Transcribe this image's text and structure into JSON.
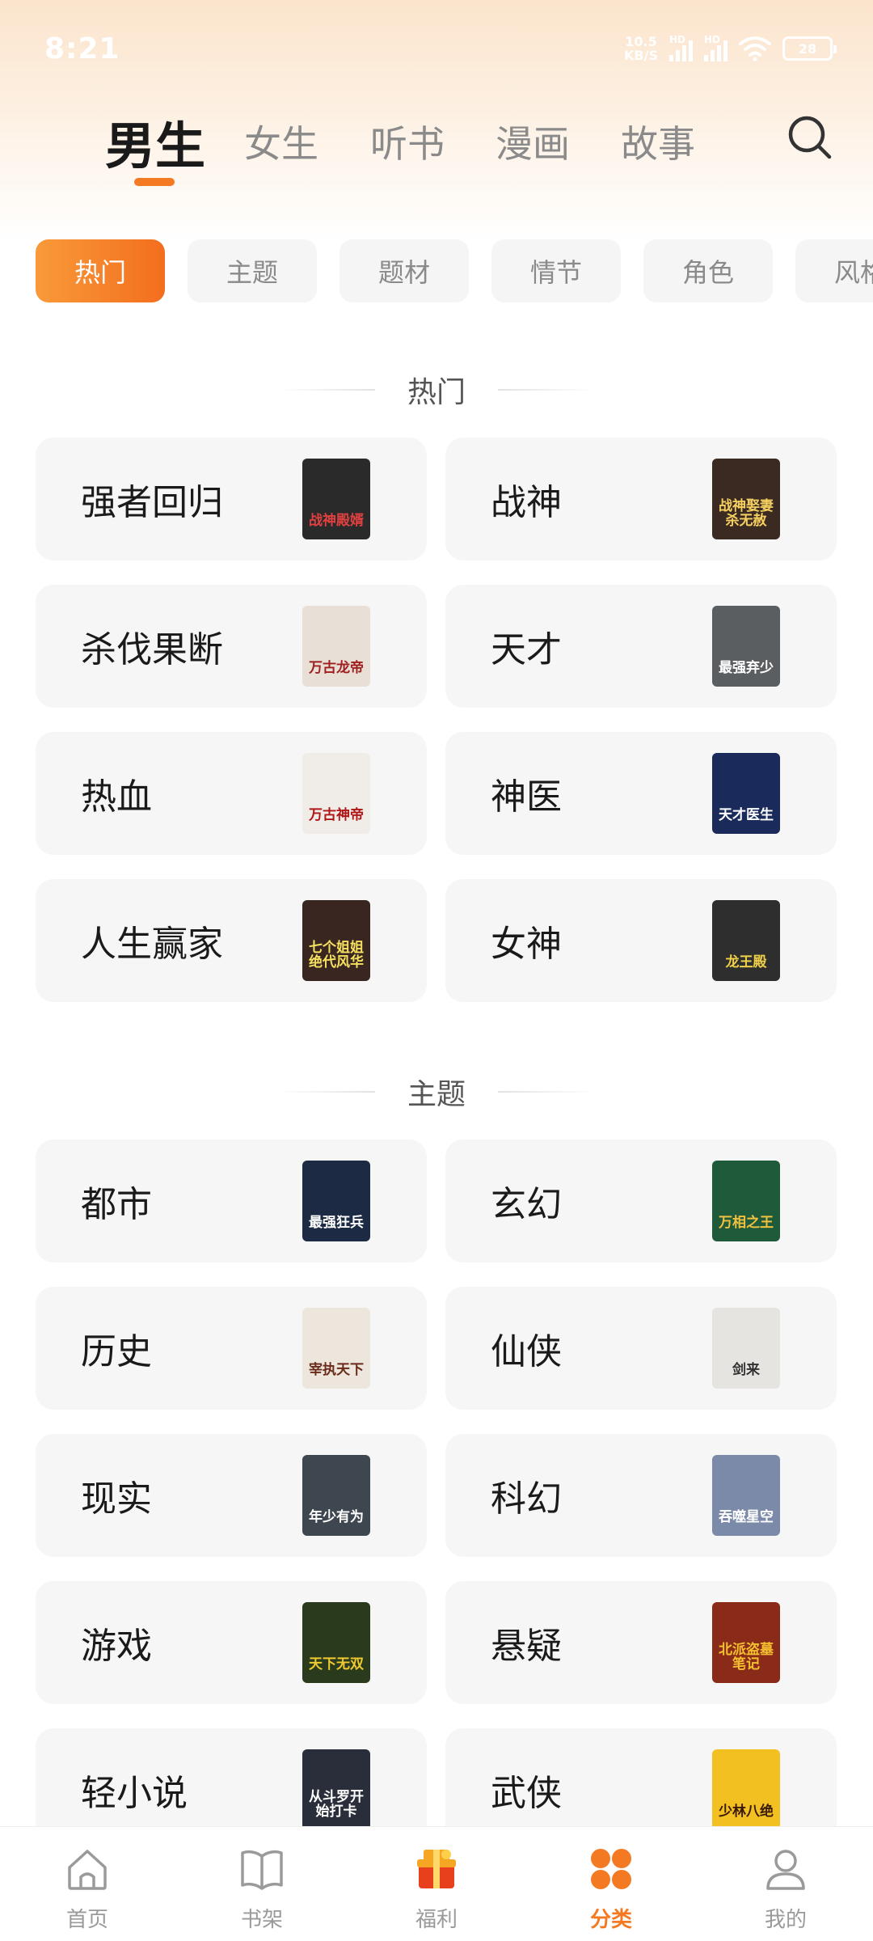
{
  "status_bar": {
    "time": "8:21",
    "net_speed": "10.5",
    "net_unit": "KB/S",
    "hd1": "HD",
    "hd2": "HD",
    "battery": "28"
  },
  "top_tabs": [
    {
      "label": "男生",
      "active": true
    },
    {
      "label": "女生",
      "active": false
    },
    {
      "label": "听书",
      "active": false
    },
    {
      "label": "漫画",
      "active": false
    },
    {
      "label": "故事",
      "active": false
    }
  ],
  "search": {
    "icon": "search-icon"
  },
  "chips": [
    {
      "label": "热门",
      "active": true
    },
    {
      "label": "主题",
      "active": false
    },
    {
      "label": "题材",
      "active": false
    },
    {
      "label": "情节",
      "active": false
    },
    {
      "label": "角色",
      "active": false
    },
    {
      "label": "风格",
      "active": false
    }
  ],
  "sections": [
    {
      "title": "热门",
      "items": [
        {
          "label": "强者回归",
          "cover_text": "战神殿婿",
          "cover_bg": "#2a2a2a",
          "cover_fg": "#e04040"
        },
        {
          "label": "战神",
          "cover_text": "战神娶妻杀无赦",
          "cover_bg": "#3b2a22",
          "cover_fg": "#f5d060"
        },
        {
          "label": "杀伐果断",
          "cover_text": "万古龙帝",
          "cover_bg": "#e8e0d6",
          "cover_fg": "#a02020"
        },
        {
          "label": "天才",
          "cover_text": "最强弃少",
          "cover_bg": "#5a5e60",
          "cover_fg": "#ffffff"
        },
        {
          "label": "热血",
          "cover_text": "万古神帝",
          "cover_bg": "#f0ece8",
          "cover_fg": "#b01818"
        },
        {
          "label": "神医",
          "cover_text": "天才医生",
          "cover_bg": "#1a2a5a",
          "cover_fg": "#ffffff"
        },
        {
          "label": "人生赢家",
          "cover_text": "七个姐姐绝代风华",
          "cover_bg": "#3a2620",
          "cover_fg": "#f5e060"
        },
        {
          "label": "女神",
          "cover_text": "龙王殿",
          "cover_bg": "#2e2e2e",
          "cover_fg": "#f0d048"
        }
      ]
    },
    {
      "title": "主题",
      "items": [
        {
          "label": "都市",
          "cover_text": "最强狂兵",
          "cover_bg": "#1c2a44",
          "cover_fg": "#ffffff"
        },
        {
          "label": "玄幻",
          "cover_text": "万相之王",
          "cover_bg": "#1f5a3a",
          "cover_fg": "#f0c040"
        },
        {
          "label": "历史",
          "cover_text": "宰执天下",
          "cover_bg": "#ede6dc",
          "cover_fg": "#6a2a1a"
        },
        {
          "label": "仙侠",
          "cover_text": "剑来",
          "cover_bg": "#e6e4e0",
          "cover_fg": "#303030"
        },
        {
          "label": "现实",
          "cover_text": "年少有为",
          "cover_bg": "#3e4650",
          "cover_fg": "#ffffff"
        },
        {
          "label": "科幻",
          "cover_text": "吞噬星空",
          "cover_bg": "#7a8aa8",
          "cover_fg": "#ffffff"
        },
        {
          "label": "游戏",
          "cover_text": "天下无双",
          "cover_bg": "#2a3a1c",
          "cover_fg": "#f0c830"
        },
        {
          "label": "悬疑",
          "cover_text": "北派盗墓笔记",
          "cover_bg": "#8a2a18",
          "cover_fg": "#f5c030"
        },
        {
          "label": "轻小说",
          "cover_text": "从斗罗开始打卡",
          "cover_bg": "#2a2e3a",
          "cover_fg": "#ffffff"
        },
        {
          "label": "武侠",
          "cover_text": "少林八绝",
          "cover_bg": "#f2c020",
          "cover_fg": "#3a1a0a"
        }
      ]
    }
  ],
  "bottom_nav": [
    {
      "label": "首页",
      "icon": "home-icon",
      "active": false
    },
    {
      "label": "书架",
      "icon": "bookshelf-icon",
      "active": false
    },
    {
      "label": "福利",
      "icon": "gift-icon",
      "active": false
    },
    {
      "label": "分类",
      "icon": "category-icon",
      "active": true
    },
    {
      "label": "我的",
      "icon": "profile-icon",
      "active": false
    }
  ],
  "colors": {
    "accent": "#f37a22",
    "card_bg": "#f6f6f6",
    "inactive_text": "#8a8a8a"
  }
}
